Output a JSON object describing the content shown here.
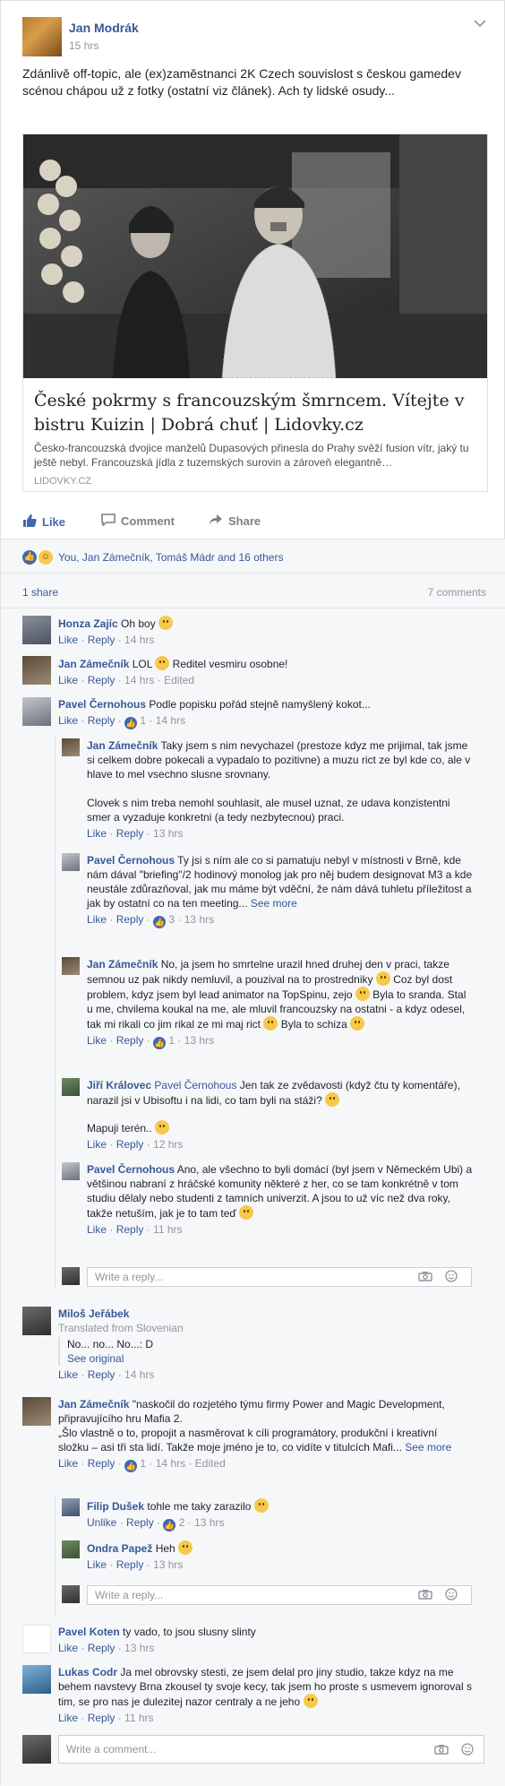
{
  "post": {
    "author": "Jan Modrák",
    "time": "15 hrs",
    "text": "Zdánlivě off-topic, ale (ex)zaměstnanci 2K Czech souvislost s českou gamedev scénou chápou už z fotky (ostatní viz článek). Ach ty lidské osudy...",
    "link": {
      "title": "České pokrmy s francouzským šmrncem. Vítejte v bistru Kuizin | Dobrá chuť | Lidovky.cz",
      "description": "Česko-francouzská dvojice manželů Dupasových přinesla do Prahy svěží fusion vítr, jaký tu ještě nebyl. Francouzská jídla z tuzemských surovin a zároveň elegantně…",
      "domain": "LIDOVKY.CZ"
    },
    "actions": {
      "like": "Like",
      "comment": "Comment",
      "share": "Share"
    },
    "reactions_text": "You, Jan Zámečník, Tomáš Mádr and 16 others",
    "shares": "1 share",
    "comments_count": "7 comments"
  },
  "comments": [
    {
      "name": "Honza Zajíc",
      "text": "Oh boy",
      "meta_like": "Like",
      "meta_reply": "Reply",
      "time": "14 hrs"
    },
    {
      "name": "Jan Zámečník",
      "text": "LOL",
      "text2": "Reditel vesmiru osobne!",
      "meta_like": "Like",
      "meta_reply": "Reply",
      "time": "14 hrs",
      "edited": "Edited"
    },
    {
      "name": "Pavel Černohous",
      "text": "Podle popisku pořád stejně namyšlený kokot...",
      "meta_like": "Like",
      "meta_reply": "Reply",
      "likes": "1",
      "time": "14 hrs"
    }
  ],
  "replies_a": [
    {
      "name": "Jan Zámečník",
      "text": "Taky jsem s nim nevychazel (prestoze kdyz me prijimal, tak jsme si celkem dobre pokecali a vypadalo to pozitivne) a muzu rict ze byl kde co, ale v hlave to mel vsechno slusne srovnany.",
      "text2": "Clovek s nim treba nemohl souhlasit, ale musel uznat, ze udava konzistentni smer a vyzaduje konkretni (a tedy nezbytecnou) praci.",
      "meta_like": "Like",
      "meta_reply": "Reply",
      "time": "13 hrs"
    },
    {
      "name": "Pavel Černohous",
      "text": "Ty jsi s ním ale co si pamatuju nebyl v místnosti v Brně, kde nám dával \"briefing\"/2 hodinový monolog jak pro něj budem designovat M3 a kde neustále zdůrazňoval, jak mu máme být vděční, že nám dává tuhletu příležitost a jak by ostatní co na ten meeting...",
      "see_more": "See more",
      "meta_like": "Like",
      "meta_reply": "Reply",
      "likes": "3",
      "time": "13 hrs"
    },
    {
      "name": "Jan Zámečník",
      "text": "No, ja jsem ho smrtelne urazil hned druhej den v praci, takze semnou uz pak nikdy nemluvil, a pouzival na to prostredniky",
      "text2": "Coz byl dost problem, kdyz jsem byl lead animator na TopSpinu, zejo",
      "text3": "Byla to sranda. Stal u me, chvilema koukal na me, ale mluvil francouzsky na ostatni - a kdyz odesel, tak mi rikali co jim rikal ze mi maj rict",
      "text4": "Byla to schiza",
      "meta_like": "Like",
      "meta_reply": "Reply",
      "likes": "1",
      "time": "13 hrs"
    },
    {
      "name": "Jiří Královec",
      "mention": "Pavel Černohous",
      "text": "Jen tak ze zvědavosti (když čtu ty komentáře), narazil jsi v Ubisoftu i na lidi, co tam byli na stáži?",
      "text2": "Mapuji terén..",
      "meta_like": "Like",
      "meta_reply": "Reply",
      "time": "12 hrs"
    },
    {
      "name": "Pavel Černohous",
      "text": "Ano, ale všechno to byli domácí (byl jsem v Německém Ubi) a většinou nabraní z hráčské komunity některé z her, co se tam konkrétně v tom studiu dělaly nebo studenti z tamních univerzit. A jsou to už víc než dva roky, takže netuším, jak je to tam teď",
      "meta_like": "Like",
      "meta_reply": "Reply",
      "time": "11 hrs"
    }
  ],
  "reply_input_placeholder": "Write a reply...",
  "comment_milos": {
    "name": "Miloš Jeřábek",
    "translated": "Translated from Slovenian",
    "text": "No... no... No...: D",
    "see_original": "See original",
    "meta_like": "Like",
    "meta_reply": "Reply",
    "time": "14 hrs"
  },
  "comment_jan2": {
    "name": "Jan Zámečník",
    "text": "\"naskočil do rozjetého týmu firmy Power and Magic Development, připravujícího hru Mafia 2.",
    "text2": "„Šlo vlastně o to, propojit a nasměrovat k cíli programátory, produkční i kreativní složku – asi tři sta lidí. Takže moje jméno je to, co vidíte v titulcích Mafi...",
    "see_more": "See more",
    "meta_like": "Like",
    "meta_reply": "Reply",
    "likes": "1",
    "time": "14 hrs",
    "edited": "Edited"
  },
  "replies_b": [
    {
      "name": "Filip Dušek",
      "text": "tohle me taky zarazilo",
      "meta_like": "Unlike",
      "meta_reply": "Reply",
      "likes": "2",
      "time": "13 hrs"
    },
    {
      "name": "Ondra Papež",
      "text": "Heh",
      "meta_like": "Like",
      "meta_reply": "Reply",
      "time": "13 hrs"
    }
  ],
  "comment_pavel_koten": {
    "name": "Pavel Koten",
    "text": "ty vado, to jsou slusny slinty",
    "meta_like": "Like",
    "meta_reply": "Reply",
    "time": "13 hrs"
  },
  "comment_lukas": {
    "name": "Lukas Codr",
    "text": "Ja mel obrovsky stesti, ze jsem delal pro jiny studio, takze kdyz na me behem navstevy Brna zkousel ty svoje kecy, tak jsem ho proste s usmevem ignoroval s tim, se pro nas je dulezitej nazor centraly a ne jeho",
    "meta_like": "Like",
    "meta_reply": "Reply",
    "time": "11 hrs"
  },
  "comment_input_placeholder": "Write a comment...",
  "colors": {
    "link": "#365899",
    "like_blue": "#4267b2",
    "muted": "#90949c",
    "bg": "#f6f7f9"
  }
}
